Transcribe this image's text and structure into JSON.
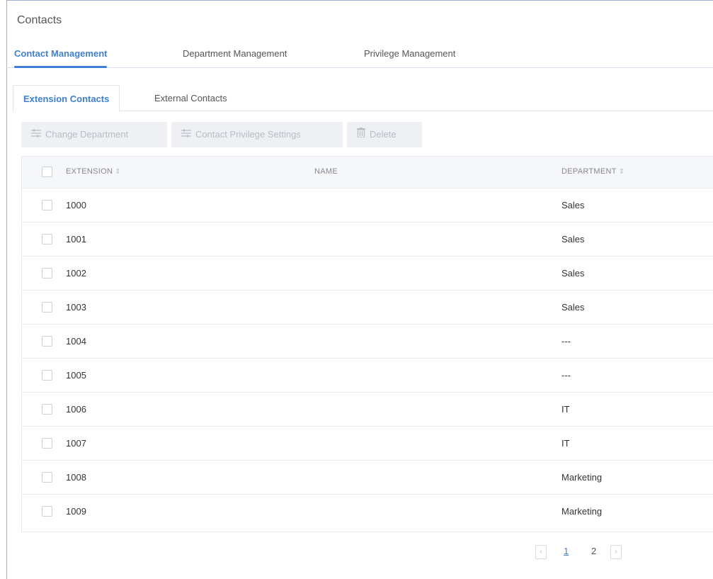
{
  "page": {
    "title": "Contacts"
  },
  "main_tabs": [
    {
      "label": "Contact Management",
      "active": true
    },
    {
      "label": "Department Management",
      "active": false
    },
    {
      "label": "Privilege Management",
      "active": false
    }
  ],
  "sub_tabs": [
    {
      "label": "Extension Contacts",
      "active": true
    },
    {
      "label": "External Contacts",
      "active": false
    }
  ],
  "toolbar": {
    "change_department": "Change Department",
    "contact_privilege": "Contact Privilege Settings",
    "delete": "Delete"
  },
  "table": {
    "columns": {
      "extension": "EXTENSION",
      "name": "NAME",
      "department": "DEPARTMENT"
    },
    "rows": [
      {
        "extension": "1000",
        "name": "",
        "department": "Sales"
      },
      {
        "extension": "1001",
        "name": "",
        "department": "Sales"
      },
      {
        "extension": "1002",
        "name": "",
        "department": "Sales"
      },
      {
        "extension": "1003",
        "name": "",
        "department": "Sales"
      },
      {
        "extension": "1004",
        "name": "",
        "department": "---"
      },
      {
        "extension": "1005",
        "name": "",
        "department": "---"
      },
      {
        "extension": "1006",
        "name": "",
        "department": "IT"
      },
      {
        "extension": "1007",
        "name": "",
        "department": "IT"
      },
      {
        "extension": "1008",
        "name": "",
        "department": "Marketing"
      },
      {
        "extension": "1009",
        "name": "",
        "department": "Marketing"
      }
    ]
  },
  "pagination": {
    "prev": "‹",
    "next": "›",
    "pages": [
      "1",
      "2"
    ],
    "current_page": "1"
  },
  "colors": {
    "accent": "#3d7fd9",
    "disabled_text": "#b7bdc6",
    "header_bg": "#f5f7fa"
  },
  "icons": {
    "change_department": "sliders-icon",
    "contact_privilege": "sliders-icon",
    "delete": "trash-icon"
  }
}
